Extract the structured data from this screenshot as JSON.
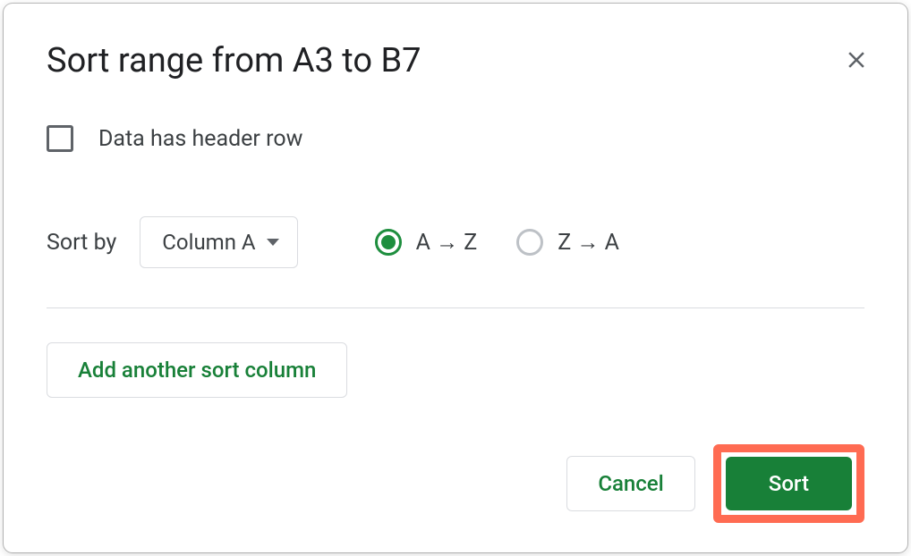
{
  "dialog": {
    "title": "Sort range from A3 to B7",
    "headerCheckbox": {
      "label": "Data has header row",
      "checked": false
    },
    "sortBy": {
      "label": "Sort by",
      "selected": "Column A",
      "options": [
        {
          "label": "A → Z",
          "selected": true
        },
        {
          "label": "Z → A",
          "selected": false
        }
      ]
    },
    "addColumnLabel": "Add another sort column",
    "footer": {
      "cancel": "Cancel",
      "sort": "Sort"
    }
  }
}
